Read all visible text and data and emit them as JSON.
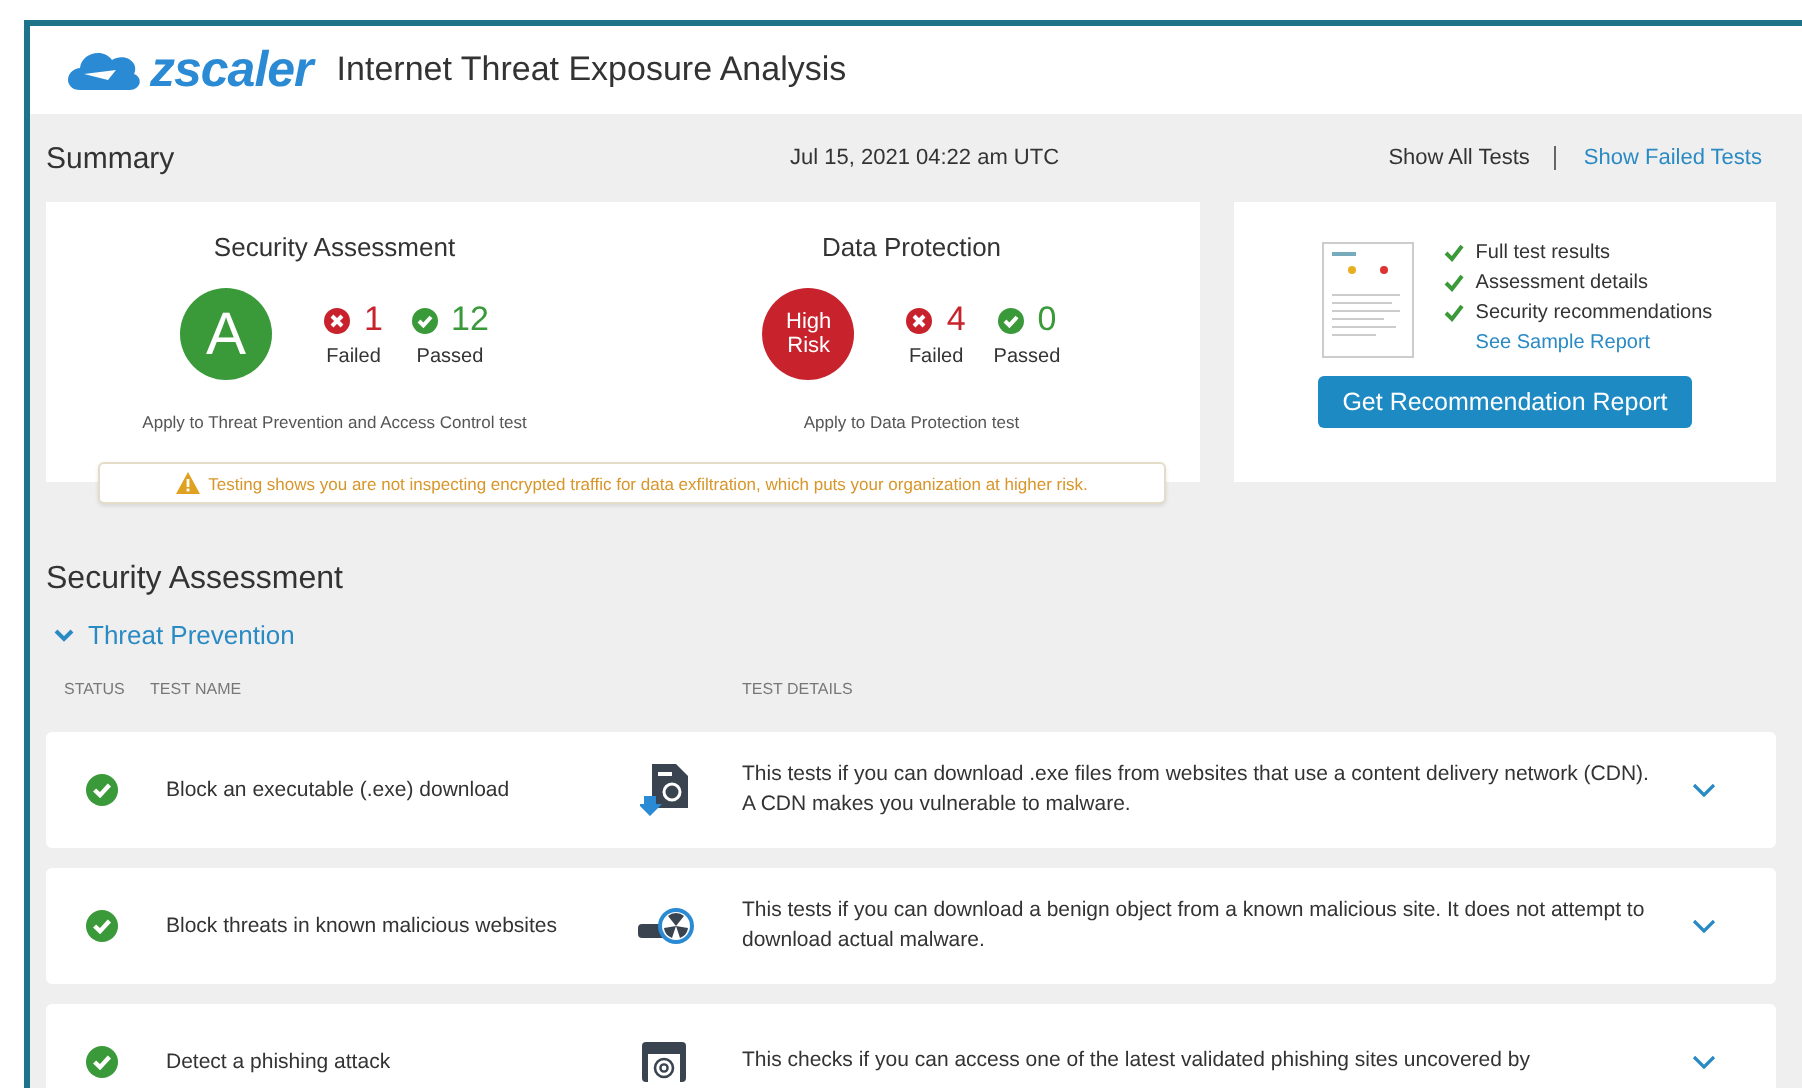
{
  "header": {
    "logo": "zscaler",
    "title": "Internet Threat Exposure Analysis"
  },
  "summary": {
    "title": "Summary",
    "date": "Jul 15, 2021 04:22 am UTC",
    "filters": [
      {
        "label": "Show All Tests",
        "selected": true
      },
      {
        "label": "Show Failed Tests",
        "selected": false
      }
    ],
    "scores": [
      {
        "title": "Security Assessment",
        "grade": "A",
        "color": "#3a9a3a",
        "failed": "1",
        "failed_label": "Failed",
        "passed": "12",
        "passed_label": "Passed",
        "note": "Apply to Threat Prevention and Access Control test"
      },
      {
        "title": "Data Protection",
        "grade": "High Risk",
        "color": "#c8232c",
        "failed": "4",
        "failed_label": "Failed",
        "passed": "0",
        "passed_label": "Passed",
        "note": "Apply to Data Protection test"
      }
    ],
    "warning": "Testing shows you are not inspecting encrypted traffic for data exfiltration, which puts your organization at higher risk.",
    "report": {
      "features": [
        "Full test results",
        "Assessment details",
        "Security recommendations"
      ],
      "sample_link": "See Sample Report",
      "button": "Get Recommendation Report"
    }
  },
  "section": {
    "title": "Security Assessment",
    "group": {
      "label": "Threat Prevention",
      "expanded": true
    },
    "columns": [
      "STATUS",
      "TEST NAME",
      "TEST DETAILS"
    ],
    "rows": [
      {
        "passed": true,
        "name": "Block an executable (.exe) download",
        "kind": "exe",
        "details": "This tests if you can download .exe files from websites that use a content delivery network (CDN). A CDN makes you vulnerable to malware."
      },
      {
        "passed": true,
        "name": "Block threats in known malicious websites",
        "kind": "malicious",
        "details": "This tests if you can download a benign object from a known malicious site. It does not attempt to download actual malware."
      },
      {
        "passed": true,
        "name": "Detect a phishing attack",
        "kind": "phishing",
        "details": "This checks if you can access one of the latest validated phishing sites uncovered by"
      }
    ]
  }
}
